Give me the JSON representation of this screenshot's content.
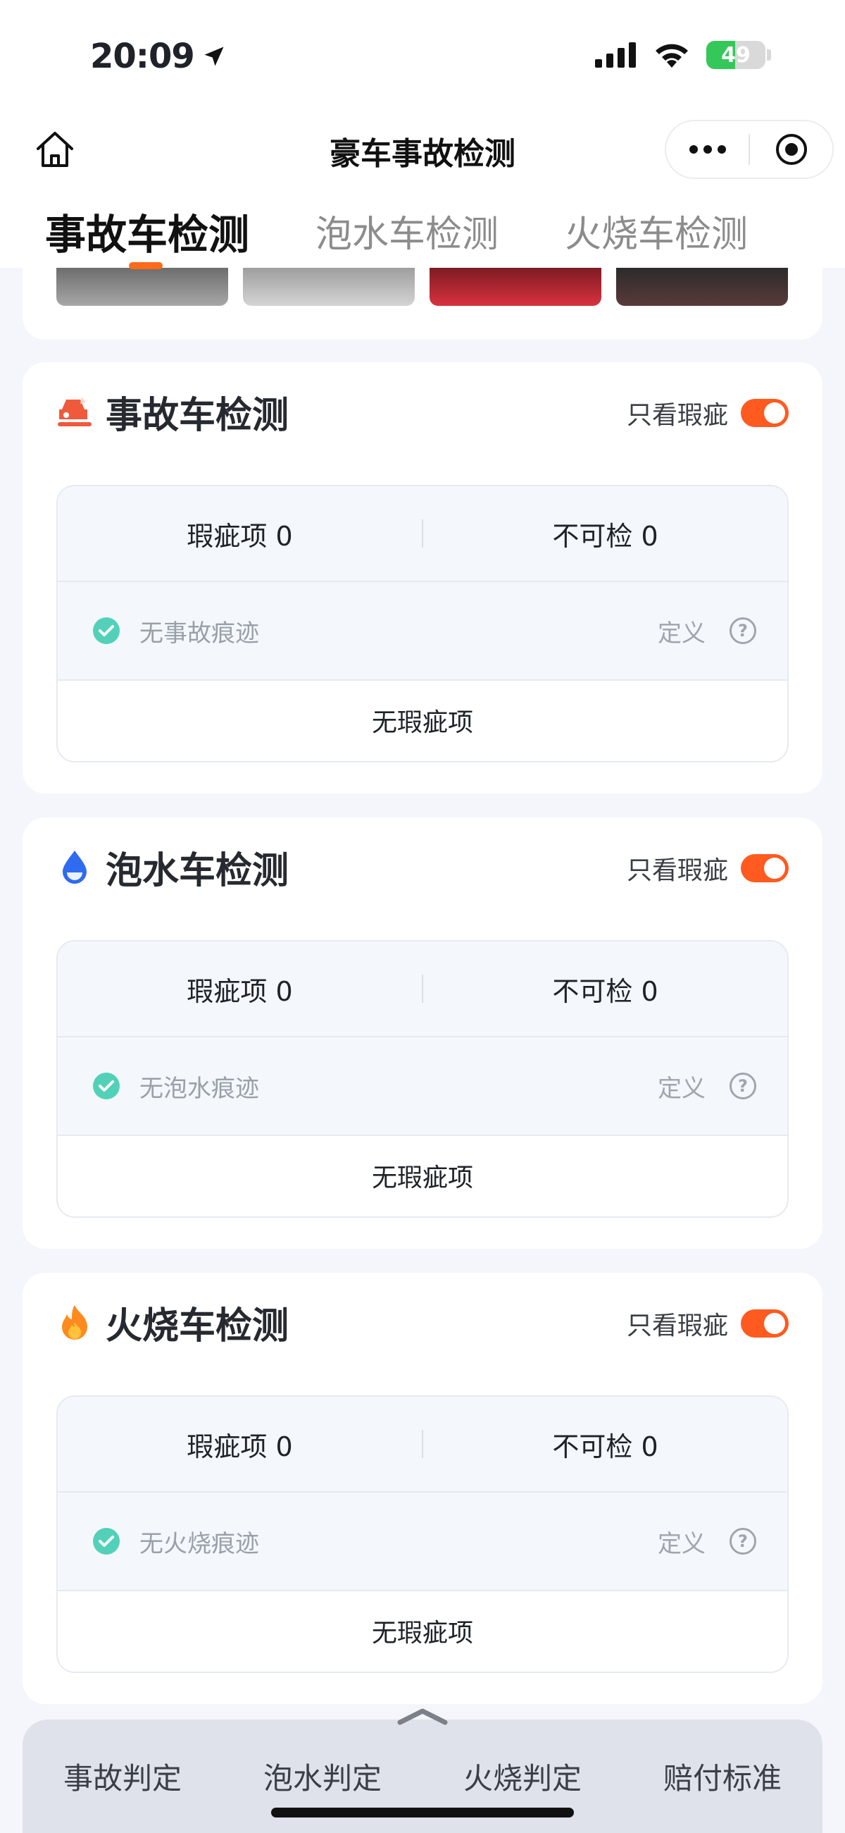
{
  "status": {
    "time": "20:09",
    "battery": "49"
  },
  "nav": {
    "title": "豪车事故检测"
  },
  "tabs": [
    {
      "label": "事故车检测",
      "active": true
    },
    {
      "label": "泡水车检测",
      "active": false
    },
    {
      "label": "火烧车检测",
      "active": false
    }
  ],
  "sections": [
    {
      "title": "事故车检测",
      "icon": "car-crash-icon",
      "filter_label": "只看瑕疵",
      "defect_stat": "瑕疵项 0",
      "uncheckable_stat": "不可检 0",
      "result": "无事故痕迹",
      "definition": "定义",
      "empty": "无瑕疵项"
    },
    {
      "title": "泡水车检测",
      "icon": "water-drop-icon",
      "filter_label": "只看瑕疵",
      "defect_stat": "瑕疵项 0",
      "uncheckable_stat": "不可检 0",
      "result": "无泡水痕迹",
      "definition": "定义",
      "empty": "无瑕疵项"
    },
    {
      "title": "火烧车检测",
      "icon": "fire-icon",
      "filter_label": "只看瑕疵",
      "defect_stat": "瑕疵项 0",
      "uncheckable_stat": "不可检 0",
      "result": "无火烧痕迹",
      "definition": "定义",
      "empty": "无瑕疵项"
    }
  ],
  "bottom_bar": {
    "items": [
      "事故判定",
      "泡水判定",
      "火烧判定",
      "赔付标准"
    ]
  },
  "colors": {
    "accent": "#ff5a1f",
    "check": "#52d1b8",
    "water": "#2e6bf0",
    "fire": "#ff8a1f"
  }
}
